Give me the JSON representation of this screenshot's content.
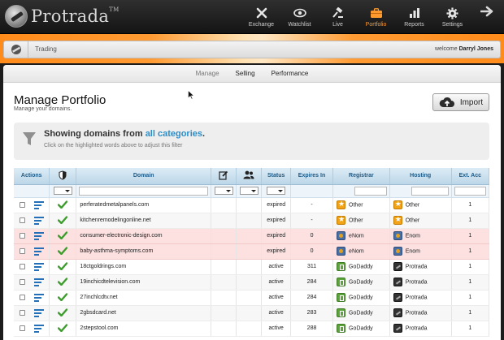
{
  "brand": {
    "name": "Protrada",
    "tm": "TM"
  },
  "nav": [
    {
      "label": "Exchange",
      "icon": "exchange-icon",
      "active": false
    },
    {
      "label": "Watchlist",
      "icon": "eye-icon",
      "active": false
    },
    {
      "label": "Live",
      "icon": "gavel-icon",
      "active": false
    },
    {
      "label": "Portfolio",
      "icon": "briefcase-icon",
      "active": true
    },
    {
      "label": "Reports",
      "icon": "bar-chart-icon",
      "active": false
    },
    {
      "label": "Settings",
      "icon": "gear-icon",
      "active": false
    }
  ],
  "breadcrumb": {
    "current": "Trading",
    "welcome_prefix": "welcome",
    "user": "Darryl Jones"
  },
  "subtabs": [
    {
      "label": "Manage",
      "active": true
    },
    {
      "label": "Selling",
      "active": false
    },
    {
      "label": "Performance",
      "active": false
    }
  ],
  "page": {
    "title": "Manage Portfolio",
    "subtitle": "Manage your domains.",
    "import_label": "Import"
  },
  "filter": {
    "prefix": "Showing domains from",
    "link": "all categories",
    "suffix": ".",
    "hint": "Click on the highlighted words above to adjust this filter"
  },
  "table": {
    "columns": {
      "actions": "Actions",
      "domain": "Domain",
      "status": "Status",
      "expires": "Expires In",
      "registrar": "Registrar",
      "hosting": "Hosting",
      "ext": "Ext. Acc"
    },
    "rows": [
      {
        "domain": "perferatedmetalpanels.com",
        "status": "expired",
        "expires": "-",
        "registrar": "Other",
        "hosting": "Other",
        "ext": "1",
        "reg_icon": "other-star-icon",
        "host_icon": "other-star-icon",
        "highlight": false
      },
      {
        "domain": "kitchenremodelingonline.net",
        "status": "expired",
        "expires": "-",
        "registrar": "Other",
        "hosting": "Other",
        "ext": "1",
        "reg_icon": "other-star-icon",
        "host_icon": "other-star-icon",
        "highlight": false
      },
      {
        "domain": "consumer-electronic-design.com",
        "status": "expired",
        "expires": "0",
        "registrar": "eNom",
        "hosting": "Enom",
        "ext": "1",
        "reg_icon": "enom-icon",
        "host_icon": "enom-icon",
        "highlight": true
      },
      {
        "domain": "baby-asthma-symptoms.com",
        "status": "expired",
        "expires": "0",
        "registrar": "eNom",
        "hosting": "Enom",
        "ext": "1",
        "reg_icon": "enom-icon",
        "host_icon": "enom-icon",
        "highlight": true
      },
      {
        "domain": "18ctgoldrings.com",
        "status": "active",
        "expires": "311",
        "registrar": "GoDaddy",
        "hosting": "Protrada",
        "ext": "1",
        "reg_icon": "godaddy-icon",
        "host_icon": "protrada-icon",
        "highlight": false
      },
      {
        "domain": "19inchicdtelevision.com",
        "status": "active",
        "expires": "284",
        "registrar": "GoDaddy",
        "hosting": "Protrada",
        "ext": "1",
        "reg_icon": "godaddy-icon",
        "host_icon": "protrada-icon",
        "highlight": false
      },
      {
        "domain": "27inchlcdtv.net",
        "status": "active",
        "expires": "284",
        "registrar": "GoDaddy",
        "hosting": "Protrada",
        "ext": "1",
        "reg_icon": "godaddy-icon",
        "host_icon": "protrada-icon",
        "highlight": false
      },
      {
        "domain": "2gbsdcard.net",
        "status": "active",
        "expires": "283",
        "registrar": "GoDaddy",
        "hosting": "Protrada",
        "ext": "1",
        "reg_icon": "godaddy-icon",
        "host_icon": "protrada-icon",
        "highlight": false
      },
      {
        "domain": "2stepstool.com",
        "status": "active",
        "expires": "288",
        "registrar": "GoDaddy",
        "hosting": "Protrada",
        "ext": "1",
        "reg_icon": "godaddy-icon",
        "host_icon": "protrada-icon",
        "highlight": false
      }
    ]
  },
  "colors": {
    "accent": "#ff9a2e",
    "link": "#2a8ec9",
    "header": "#1e5a86",
    "highlight_row": "#fde1e1"
  }
}
